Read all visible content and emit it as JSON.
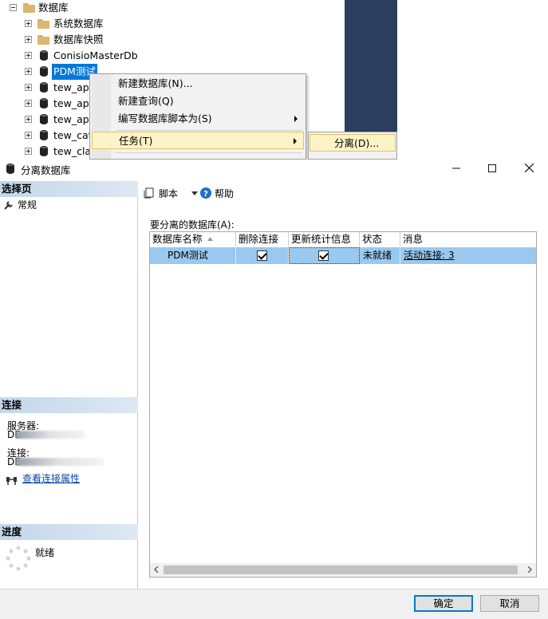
{
  "tree": {
    "root_label": "数据库",
    "items": [
      {
        "label": "系统数据库",
        "icon": "folder-icon"
      },
      {
        "label": "数据库快照",
        "icon": "folder-icon"
      },
      {
        "label": "ConisioMasterDb",
        "icon": "database-icon"
      },
      {
        "label": "PDM测试",
        "icon": "database-icon"
      },
      {
        "label": "tew_app",
        "icon": "database-icon"
      },
      {
        "label": "tew_app",
        "icon": "database-icon"
      },
      {
        "label": "tew_app",
        "icon": "database-icon"
      },
      {
        "label": "tew_cata",
        "icon": "database-icon"
      },
      {
        "label": "tew_clas",
        "icon": "database-icon"
      }
    ]
  },
  "context_menu": {
    "items": [
      "新建数据库(N)...",
      "新建查询(Q)",
      "编写数据库脚本为(S)",
      "任务(T)"
    ],
    "submenu_item": "分离(D)..."
  },
  "dialog": {
    "title": "分离数据库",
    "left": {
      "select_page_heading": "选择页",
      "page_general": "常规",
      "connection_heading": "连接",
      "server_label": "服务器:",
      "server_prefix": "DE",
      "connection_label": "连接:",
      "connection_prefix": "DE",
      "view_connection_link": "查看连接属性",
      "progress_heading": "进度",
      "progress_status": "就绪"
    },
    "toolbar": {
      "script_label": "脚本",
      "help_label": "帮助"
    },
    "grid_caption": "要分离的数据库(A):",
    "grid": {
      "headers": [
        "数据库名称",
        "删除连接",
        "更新统计信息",
        "状态",
        "消息"
      ],
      "rows": [
        {
          "name": "PDM测试",
          "drop_connections": true,
          "update_statistics": true,
          "status": "未就绪",
          "message": "活动连接: 3"
        }
      ]
    },
    "buttons": {
      "ok": "确定",
      "cancel": "取消"
    }
  },
  "colors": {
    "selection": "#0078d7",
    "row_highlight": "#99c9ef",
    "menu_highlight": "#fcf3c8",
    "section_header": "#c3d7ea",
    "dark_panel": "#2c3e5e"
  }
}
